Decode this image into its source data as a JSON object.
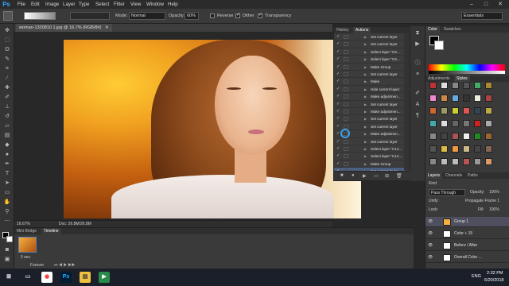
{
  "app": {
    "logo": "Ps",
    "accent": "#31a8ff"
  },
  "menu": [
    "File",
    "Edit",
    "Image",
    "Layer",
    "Type",
    "Select",
    "Filter",
    "View",
    "Window",
    "Help"
  ],
  "window_controls": {
    "minimize": "–",
    "maximize": "□",
    "close": "✕"
  },
  "options_bar": {
    "mode_label": "Mode:",
    "mode_value": "Normal",
    "opacity_label": "Opacity:",
    "opacity_value": "60%",
    "reverse": "Reverse",
    "dither": "Dither",
    "transparency": "Transparency",
    "workspace": "Essentials"
  },
  "document": {
    "tab": "woman-1320810 1.jpg @ 16.7% (RGB/8#)",
    "zoom": "16.67%",
    "doc_size": "Doc: 26.8M/26.8M"
  },
  "timeline": {
    "tabs": [
      "Mini Bridge",
      "Timeline"
    ],
    "frame_time": "0 sec.",
    "loop": "Forever"
  },
  "history_panel": {
    "tabs": [
      "History",
      "Actions"
    ],
    "rows": [
      "Set current layer",
      "Set current layer",
      "Select layer \"C5...",
      "Select layer \"C5...",
      "Make Group",
      "Set current layer",
      "Make",
      "Hide current layer",
      "Make adjustmen...",
      "Set current layer",
      "Make adjustmen...",
      "Set current layer",
      "Set current layer",
      "Make adjustmen...",
      "Set current layer",
      "Select layer \"C14...",
      "Select layer \"C14...",
      "Make Group",
      "Set current layer"
    ]
  },
  "right_panel": {
    "color_tabs": [
      "Color",
      "Swatches"
    ],
    "adj_tabs": [
      "Adjustments",
      "Styles"
    ],
    "layers_tabs": [
      "Layers",
      "Channels",
      "Paths"
    ],
    "kind_label": "Kind",
    "blend_mode": "Pass Through",
    "opacity_label": "Opacity:",
    "opacity_value": "100%",
    "unify_label": "Unify:",
    "propagate_label": "Propagate Frame 1",
    "lock_label": "Lock:",
    "fill_label": "Fill:",
    "fill_value": "100%",
    "layers": [
      "Group 1",
      "Color + 15",
      "Before / After",
      "Overall Color ..."
    ]
  },
  "taskbar": {
    "lang": "ENG",
    "time": "2:32 PM",
    "date": "6/20/2018"
  }
}
